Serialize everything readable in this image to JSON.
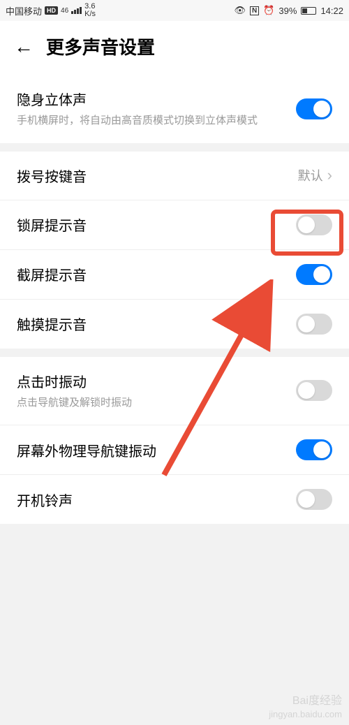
{
  "status_bar": {
    "carrier": "中国移动",
    "hd_badge": "HD",
    "net_gen": "46",
    "speed": "3.6\nK/s",
    "nfc": "N",
    "alarm": "⏰",
    "battery_pct": "39%",
    "time": "14:22"
  },
  "header": {
    "title": "更多声音设置"
  },
  "rows": {
    "stereo": {
      "title": "隐身立体声",
      "sub": "手机横屏时，将自动由高音质模式切换到立体声模式"
    },
    "dial": {
      "title": "拨号按键音",
      "value": "默认"
    },
    "lock": {
      "title": "锁屏提示音"
    },
    "screenshot": {
      "title": "截屏提示音"
    },
    "touch": {
      "title": "触摸提示音"
    },
    "tap_vibrate": {
      "title": "点击时振动",
      "sub": "点击导航键及解锁时振动"
    },
    "nav_vibrate": {
      "title": "屏幕外物理导航键振动"
    },
    "boot_sound": {
      "title": "开机铃声"
    }
  },
  "toggles": {
    "stereo": true,
    "lock": false,
    "screenshot": true,
    "touch": false,
    "tap_vibrate": false,
    "nav_vibrate": true,
    "boot_sound": false
  },
  "highlight": {
    "target": "lock",
    "box_color": "#e94b35"
  },
  "watermark": {
    "brand": "Bai度经验",
    "url": "jingyan.baidu.com"
  }
}
